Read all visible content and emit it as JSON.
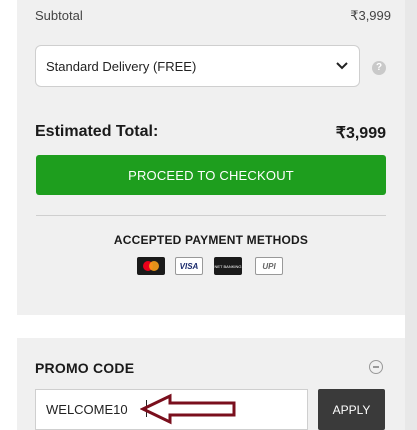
{
  "summary": {
    "subtotal_label": "Subtotal",
    "subtotal_value": "₹3,999",
    "delivery_option": "Standard Delivery (FREE)",
    "help_icon": "question-circle-icon",
    "estimated_total_label": "Estimated Total:",
    "estimated_total_value": "₹3,999",
    "checkout_label": "PROCEED TO CHECKOUT"
  },
  "payment": {
    "title": "ACCEPTED PAYMENT METHODS",
    "methods": [
      "mastercard-icon",
      "VISA",
      "NET BANKING",
      "UPI"
    ]
  },
  "promo": {
    "title": "PROMO CODE",
    "code_value": "WELCOME10",
    "apply_label": "APPLY"
  },
  "colors": {
    "checkout_green": "#1e9e1e",
    "apply_dark": "#3a3a3a",
    "panel_bg": "#f0f0f0",
    "arrow_maroon": "#7a0f1d"
  }
}
